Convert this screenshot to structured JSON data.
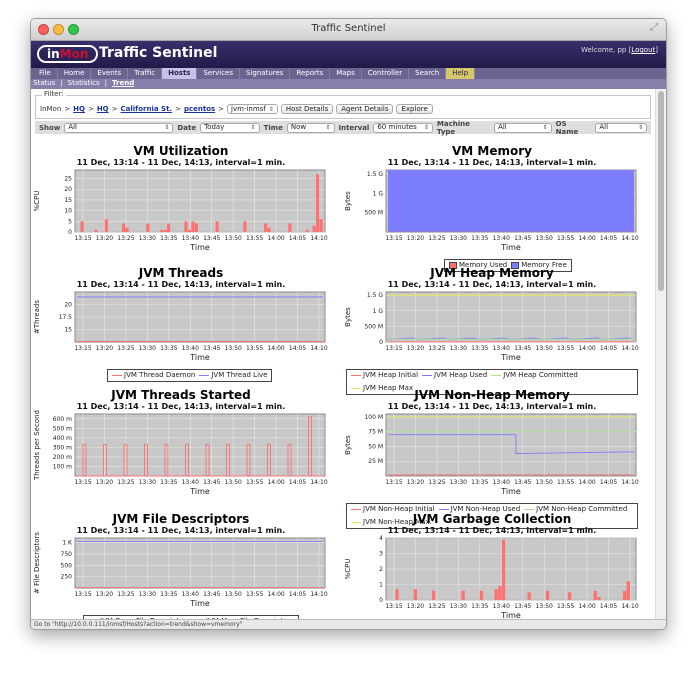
{
  "window": {
    "title": "Traffic Sentinel"
  },
  "header": {
    "logo_prefix": "in",
    "logo_main": "Mon",
    "app_title": "Traffic Sentinel",
    "welcome": "Welcome, pp [",
    "logout": "Logout",
    "welcome_end": "]"
  },
  "nav": {
    "items": [
      "File",
      "Home",
      "Events",
      "Traffic",
      "Hosts",
      "Services",
      "Signatures",
      "Reports",
      "Maps",
      "Controller",
      "Search",
      "Help"
    ],
    "active": "Hosts"
  },
  "subnav": {
    "items": [
      "Status",
      "Statistics",
      "Trend"
    ],
    "selected": "Trend"
  },
  "filter": {
    "legend": "Filter:",
    "crumbs": [
      {
        "text": "InMon",
        "link": false
      },
      {
        "text": "HQ",
        "link": true
      },
      {
        "text": "HQ",
        "link": true
      },
      {
        "text": "California St.",
        "link": true
      },
      {
        "text": "pcentos",
        "link": true
      }
    ],
    "host_select": "jvm-inmsf",
    "buttons": [
      "Host Details",
      "Agent Details",
      "Explore"
    ]
  },
  "showbar": {
    "fields": [
      {
        "label": "Show",
        "value": "All"
      },
      {
        "label": "Date",
        "value": "Today"
      },
      {
        "label": "Time",
        "value": "Now"
      },
      {
        "label": "Interval",
        "value": "60 minutes"
      },
      {
        "label": "Machine Type",
        "value": "All"
      },
      {
        "label": "OS Name",
        "value": "All"
      }
    ]
  },
  "statusbar": "Go to \"http://10.0.0.111/inmsf/Hosts?action=trend&show=vmemory\"",
  "colors": {
    "red": "#ff7070",
    "blue": "#7c7cff",
    "green": "#a6e38e",
    "yellow": "#e8e85a",
    "plot_bg": "#c8c8c8"
  },
  "chart_data": [
    {
      "type": "bar",
      "title": "VM Utilization",
      "subtitle": "11 Dec, 13:14 -  11 Dec, 14:13, interval=1 min.",
      "xlabel": "Time",
      "ylabel": "%CPU",
      "x_ticks": [
        "13:15",
        "13:20",
        "13:25",
        "13:30",
        "13:35",
        "13:40",
        "13:45",
        "13:50",
        "13:55",
        "14:00",
        "14:05",
        "14:10"
      ],
      "y_ticks": [
        "0",
        "5",
        "10",
        "15",
        "20",
        "25"
      ],
      "ylim": [
        0,
        29
      ],
      "series": [
        {
          "color": "red",
          "values": [
            0,
            5,
            0,
            0,
            0,
            1,
            0,
            0,
            6,
            0,
            0,
            0,
            0,
            4,
            2,
            0,
            0,
            0,
            0,
            0,
            4,
            0,
            0,
            0,
            1,
            1,
            4,
            0,
            0,
            0,
            0,
            5,
            1,
            5,
            4,
            0,
            0,
            0,
            0,
            0,
            5,
            0,
            0,
            0,
            0,
            0,
            0,
            0,
            5,
            0,
            0,
            0,
            0,
            0,
            4,
            2,
            0,
            0,
            0,
            0,
            0,
            4,
            0,
            0,
            0,
            0,
            1,
            0,
            3,
            27,
            6
          ]
        }
      ]
    },
    {
      "type": "area",
      "title": "VM Memory",
      "subtitle": "11 Dec, 13:14 -  11 Dec, 14:13, interval=1 min.",
      "xlabel": "Time",
      "ylabel": "Bytes",
      "x_ticks": [
        "13:15",
        "13:20",
        "13:25",
        "13:30",
        "13:35",
        "13:40",
        "13:45",
        "13:50",
        "13:55",
        "14:00",
        "14:05",
        "14:10"
      ],
      "y_ticks": [
        "500 M",
        "1 G",
        "1.5 G"
      ],
      "ylim": [
        0,
        1.6
      ],
      "series": [
        {
          "name": "Memory Used",
          "color": "red",
          "value": 0.005
        },
        {
          "name": "Memory Free",
          "color": "blue",
          "value": 1.6
        }
      ]
    },
    {
      "type": "line",
      "title": "JVM Threads",
      "subtitle": "11 Dec, 13:14 -  11 Dec, 14:13, interval=1 min.",
      "xlabel": "Time",
      "ylabel": "#Threads",
      "x_ticks": [
        "13:15",
        "13:20",
        "13:25",
        "13:30",
        "13:35",
        "13:40",
        "13:45",
        "13:50",
        "13:55",
        "14:00",
        "14:05",
        "14:10"
      ],
      "y_ticks": [
        "15",
        "17.5",
        "20"
      ],
      "ylim": [
        12.5,
        22.5
      ],
      "series": [
        {
          "name": "JVM Thread Daemon",
          "color": "red",
          "value": 12.6
        },
        {
          "name": "JVM Thread Live",
          "color": "blue",
          "value": 21.5
        }
      ]
    },
    {
      "type": "line",
      "title": "JVM Heap Memory",
      "subtitle": "11 Dec, 13:14 -  11 Dec, 14:13, interval=1 min.",
      "xlabel": "Time",
      "ylabel": "Bytes",
      "x_ticks": [
        "13:15",
        "13:20",
        "13:25",
        "13:30",
        "13:35",
        "13:40",
        "13:45",
        "13:50",
        "13:55",
        "14:00",
        "14:05",
        "14:10"
      ],
      "y_ticks": [
        "0",
        "500 M",
        "1 G",
        "1.5 G"
      ],
      "ylim": [
        0,
        1.6
      ],
      "series": [
        {
          "name": "JVM Heap Initial",
          "color": "red",
          "value": 0.005
        },
        {
          "name": "JVM Heap Used",
          "color": "blue",
          "value": 0.08
        },
        {
          "name": "JVM Heap Committed",
          "color": "green",
          "value": 0.09
        },
        {
          "name": "JVM Heap Max",
          "color": "yellow",
          "value": 1.5
        }
      ]
    },
    {
      "type": "bar",
      "title": "JVM Threads Started",
      "subtitle": "11 Dec, 13:14 -  11 Dec, 14:13, interval=1 min.",
      "xlabel": "Time",
      "ylabel": "Threads per Second",
      "x_ticks": [
        "13:15",
        "13:20",
        "13:25",
        "13:30",
        "13:35",
        "13:40",
        "13:45",
        "13:50",
        "13:55",
        "14:00",
        "14:05",
        "14:10"
      ],
      "y_ticks": [
        "100 m",
        "200 m",
        "300 m",
        "400 m",
        "500 m",
        "600 m"
      ],
      "ylim": [
        0,
        650
      ],
      "series": [
        {
          "color": "red",
          "pulse_height": 330,
          "last_height": 620,
          "pulses": 12
        }
      ]
    },
    {
      "type": "line",
      "title": "JVM Non-Heap Memory",
      "subtitle": "11 Dec, 13:14 -  11 Dec, 14:13, interval=1 min.",
      "xlabel": "Time",
      "ylabel": "Bytes",
      "x_ticks": [
        "13:15",
        "13:20",
        "13:25",
        "13:30",
        "13:35",
        "13:40",
        "13:45",
        "13:50",
        "13:55",
        "14:00",
        "14:05",
        "14:10"
      ],
      "y_ticks": [
        "25 M",
        "50 M",
        "75 M",
        "100 M"
      ],
      "ylim": [
        0,
        105
      ],
      "series": [
        {
          "name": "JVM Non-Heap Initial",
          "color": "red",
          "value": 2
        },
        {
          "name": "JVM Non-Heap Used",
          "color": "blue",
          "before": 70,
          "after": 38
        },
        {
          "name": "JVM Non-Heap Committed",
          "color": "green",
          "value": 75
        },
        {
          "name": "JVM Non-Heap Max.",
          "color": "yellow",
          "value": 100
        }
      ]
    },
    {
      "type": "line",
      "title": "JVM File Descriptors",
      "subtitle": "11 Dec, 13:14 -  11 Dec, 14:13, interval=1 min.",
      "xlabel": "Time",
      "ylabel": "# File Descriptors",
      "x_ticks": [
        "13:15",
        "13:20",
        "13:25",
        "13:30",
        "13:35",
        "13:40",
        "13:45",
        "13:50",
        "13:55",
        "14:00",
        "14:05",
        "14:10"
      ],
      "y_ticks": [
        "250",
        "500",
        "750",
        "1 K"
      ],
      "ylim": [
        0,
        1100
      ],
      "series": [
        {
          "name": "JVM Open File Descriptors",
          "color": "red",
          "value": 10
        },
        {
          "name": "JVM Max. File Descriptors",
          "color": "blue",
          "value": 1024
        }
      ]
    },
    {
      "type": "bar",
      "title": "JVM Garbage Collection",
      "subtitle": "11 Dec, 13:14 -  11 Dec, 14:13, interval=1 min.",
      "xlabel": "Time",
      "ylabel": "%CPU",
      "x_ticks": [
        "13:15",
        "13:20",
        "13:25",
        "13:30",
        "13:35",
        "13:40",
        "13:45",
        "13:50",
        "13:55",
        "14:00",
        "14:05",
        "14:10"
      ],
      "y_ticks": [
        "0",
        "1",
        "2",
        "3",
        "4"
      ],
      "ylim": [
        0,
        4
      ],
      "series": [
        {
          "color": "red",
          "values": [
            0,
            0,
            0.7,
            0,
            0,
            0,
            0,
            0.7,
            0,
            0,
            0,
            0,
            0.6,
            0,
            0,
            0,
            0,
            0,
            0,
            0,
            0.6,
            0,
            0,
            0,
            0,
            0.6,
            0,
            0,
            0,
            0.7,
            0.9,
            3.9,
            0,
            0,
            0,
            0,
            0,
            0,
            0.5,
            0,
            0,
            0,
            0,
            0.6,
            0,
            0,
            0,
            0,
            0,
            0.5,
            0,
            0,
            0,
            0,
            0,
            0,
            0.6,
            0.2,
            0,
            0,
            0,
            0,
            0,
            0,
            0.6,
            1.2,
            0
          ]
        }
      ]
    }
  ]
}
